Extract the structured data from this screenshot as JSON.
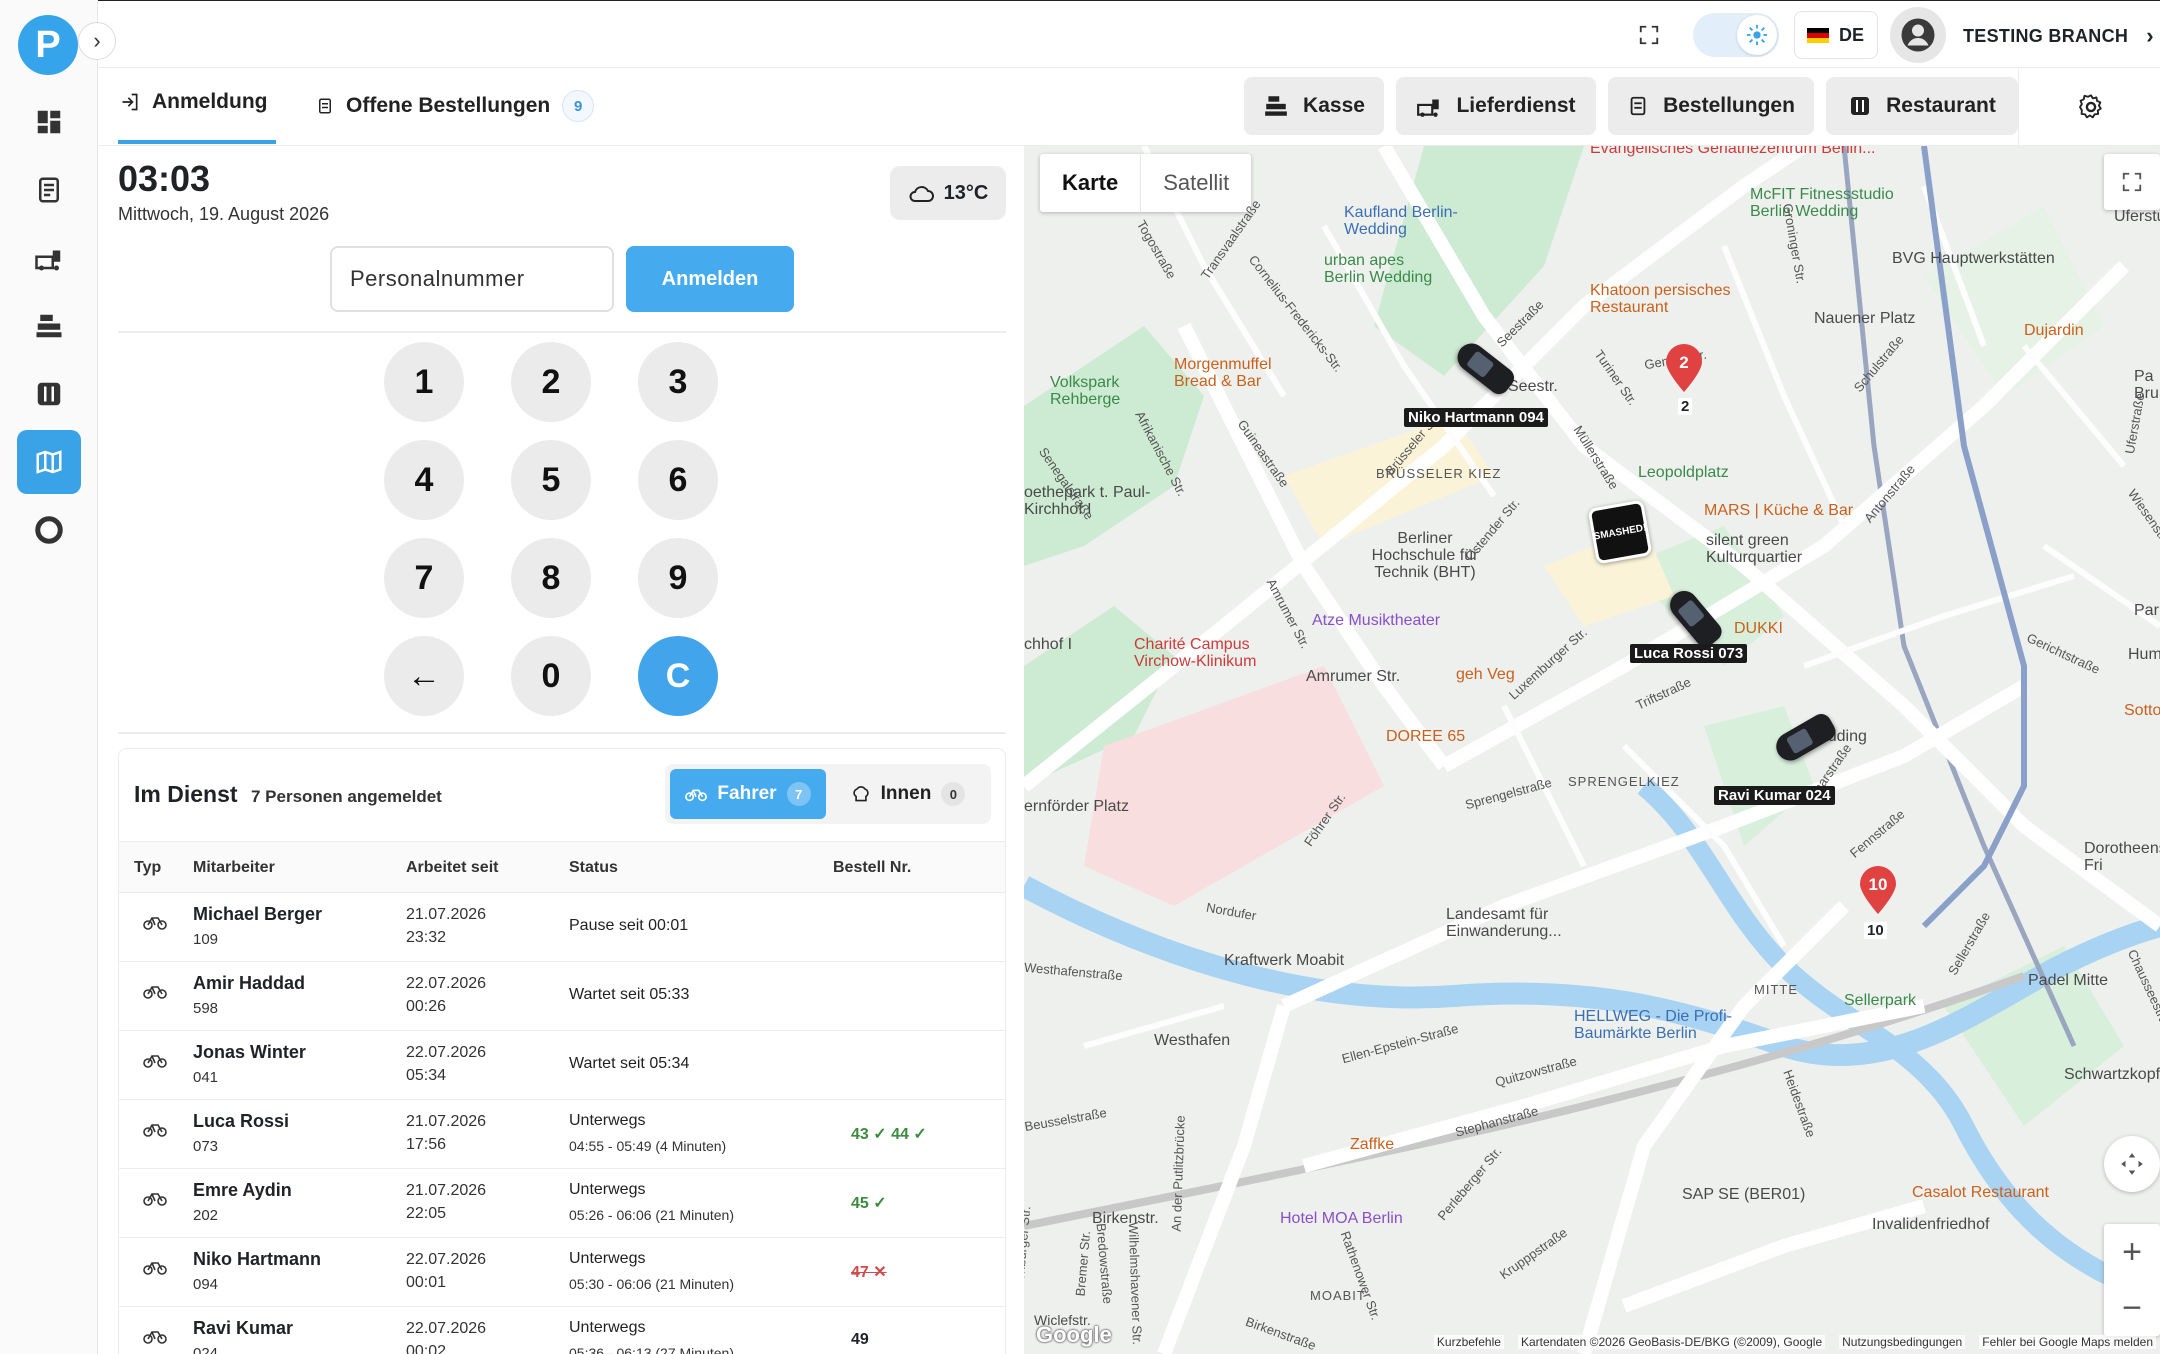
{
  "app": {
    "logo_letter": "P",
    "branch": "TESTING BRANCH",
    "language": "DE",
    "accent": "#45aaee"
  },
  "sidebar": {
    "items": [
      {
        "name": "dashboard-icon",
        "active": false
      },
      {
        "name": "receipt-icon",
        "active": false
      },
      {
        "name": "delivery-icon",
        "active": false
      },
      {
        "name": "cash-register-icon",
        "active": false
      },
      {
        "name": "restaurant-icon",
        "active": false
      },
      {
        "name": "map-icon",
        "active": true
      },
      {
        "name": "support-icon",
        "active": false
      }
    ]
  },
  "tabs": {
    "login": "Anmeldung",
    "open_orders": "Offene Bestellungen",
    "open_orders_count": "9"
  },
  "nav": {
    "kasse": "Kasse",
    "lieferdienst": "Lieferdienst",
    "bestellungen": "Bestellungen",
    "restaurant": "Restaurant"
  },
  "clock": {
    "time": "03:03",
    "date": "Mittwoch, 19. August 2026",
    "weather": "13°C"
  },
  "login": {
    "placeholder": "Personalnummer",
    "button": "Anmelden",
    "keys": [
      "1",
      "2",
      "3",
      "4",
      "5",
      "6",
      "7",
      "8",
      "9",
      "←",
      "0",
      "C"
    ]
  },
  "duty": {
    "title": "Im Dienst",
    "subtitle": "7 Personen angemeldet",
    "drivers_label": "Fahrer",
    "drivers_count": "7",
    "inside_label": "Innen",
    "inside_count": "0",
    "columns": [
      "Typ",
      "Mitarbeiter",
      "Arbeitet seit",
      "Status",
      "Bestell Nr."
    ],
    "rows": [
      {
        "name": "Michael Berger",
        "id": "109",
        "date": "21.07.2026",
        "time": "23:32",
        "status": "Pause seit 00:01",
        "detail": "",
        "orders": []
      },
      {
        "name": "Amir Haddad",
        "id": "598",
        "date": "22.07.2026",
        "time": "00:26",
        "status": "Wartet seit 05:33",
        "detail": "",
        "orders": []
      },
      {
        "name": "Jonas Winter",
        "id": "041",
        "date": "22.07.2026",
        "time": "05:34",
        "status": "Wartet seit 05:34",
        "detail": "",
        "orders": []
      },
      {
        "name": "Luca Rossi",
        "id": "073",
        "date": "21.07.2026",
        "time": "17:56",
        "status": "Unterwegs",
        "detail": "04:55 - 05:49 (4 Minuten)",
        "orders": [
          {
            "text": "43 ✓ 44 ✓",
            "state": "ok"
          }
        ]
      },
      {
        "name": "Emre Aydin",
        "id": "202",
        "date": "21.07.2026",
        "time": "22:05",
        "status": "Unterwegs",
        "detail": "05:26 - 06:06 (21 Minuten)",
        "orders": [
          {
            "text": "45 ✓",
            "state": "ok"
          }
        ]
      },
      {
        "name": "Niko Hartmann",
        "id": "094",
        "date": "22.07.2026",
        "time": "00:01",
        "status": "Unterwegs",
        "detail": "05:30 - 06:06 (21 Minuten)",
        "orders": [
          {
            "text": "47 ✕",
            "state": "bad"
          }
        ]
      },
      {
        "name": "Ravi Kumar",
        "id": "024",
        "date": "22.07.2026",
        "time": "00:02",
        "status": "Unterwegs",
        "detail": "05:36 - 06:13 (27 Minuten)",
        "orders": [
          {
            "text": "49",
            "state": "plain"
          }
        ]
      }
    ]
  },
  "map": {
    "type_map": "Karte",
    "type_satellite": "Satellit",
    "drivers": [
      "Niko Hartmann 094",
      "Luca Rossi 073",
      "Ravi Kumar 024"
    ],
    "pins": [
      "2",
      "10"
    ],
    "pin_labels": [
      "2",
      "10"
    ],
    "store_logo": "SMASHED!",
    "labels": {
      "l1": "Evangelisches Geriatriezentrum Berlin...",
      "l2": "McFIT Fitnessstudio Berlin Wedding",
      "l3": "Uferstudio",
      "l4": "Kaufland Berlin-Wedding",
      "l5": "urban apes Berlin Wedding",
      "l6": "BVG Hauptwerkstätten",
      "l7": "Khatoon persisches Restaurant",
      "l8": "Nauener Platz",
      "l9": "Dujardin",
      "l10": "Morgenmuffel Bread & Bar",
      "l11": "Volkspark Rehberge",
      "l12": "Seestr.",
      "l13": "Leopoldplatz",
      "l14": "BRÜSSELER KIEZ",
      "l15": "oethepark t. Paul-Kirchhof I",
      "l16": "MARS | Küche & Bar",
      "l17": "silent green Kulturquartier",
      "l18": "Berliner Hochschule für Technik (BHT)",
      "l19": "DUKKI",
      "l20": "Atze Musiktheater",
      "l21": "Charité Campus Virchow-Klinikum",
      "l22": "Amrumer Str.",
      "l23": "geh Veg",
      "l24": "SPRENGELKIEZ",
      "l25": "Wedding",
      "l26": "DOREE 65",
      "l27": "Dorotheenst Fri",
      "l28": "Landesamt für Einwanderung...",
      "l29": "Kraftwerk Moabit",
      "l30": "MITTE",
      "l31": "Padel Mitte",
      "l32": "Sellerpark",
      "l33": "HELLWEG - Die Profi-Baumärkte Berlin",
      "l34": "Westhafen",
      "l35": "Schwartzkopf",
      "l36": "Zaffke",
      "l37": "SAP SE (BER01)",
      "l38": "Casalot Restaurant",
      "l39": "Invalidenfriedhof",
      "l40": "Birkenstr.",
      "l41": "Hotel MOA Berlin",
      "l42": "MOABIT",
      "l43": "ernförder Platz",
      "l44": "chhof I",
      "l45": "Wiclefstr.",
      "l46": "Pa Brun",
      "l47": "Par",
      "l48": "Hum",
      "l49": "Sotto"
    },
    "streets": {
      "s1": "Transvaalstraße",
      "s2": "Seestraße",
      "s3": "Müllerstraße",
      "s4": "Afrikanische Str.",
      "s5": "Amrumer Str.",
      "s6": "Luxemburger Str.",
      "s7": "Föhrer Str.",
      "s8": "Triftstraße",
      "s9": "Fennstraße",
      "s10": "Sellerstraße",
      "s11": "Ellen-Epstein-Straße",
      "s12": "Heidestraße",
      "s13": "Perleberger Str.",
      "s14": "Rathenower Str.",
      "s15": "Stephanstraße",
      "s16": "Quitzowstraße",
      "s17": "Schulstraße",
      "s18": "Antonstraße",
      "s19": "Sprengelstraße",
      "s20": "Nordufer",
      "s21": "Guineastraße",
      "s22": "Togostraße",
      "s23": "Cornelius-Fredericks-Str.",
      "s24": "Ostender Str.",
      "s25": "Brüsseler Str.",
      "s26": "Turiner Str.",
      "s27": "Genter Str.",
      "s28": "Groninger Str.",
      "s29": "Senegalstraße",
      "s30": "An der Putlitzbrücke",
      "s31": "Birkenstraße",
      "s32": "Bremer Str.",
      "s33": "Krupppstraße",
      "s34": "Lynarstraße",
      "s35": "Gerichtstraße",
      "s36": "Uferstraße",
      "s37": "Wiesenstraße",
      "s38": "Chausseestraße",
      "s39": "Wilhelmshavener Str.",
      "s40": "Bredowstraße",
      "s41": "Oldenburger Str.",
      "s42": "Beusselstraße",
      "s43": "Kurzbefehle",
      "s44": "Westhafenstraße"
    },
    "attribution": {
      "logo": "Google",
      "shortcuts": "Kurzbefehle",
      "data": "Kartendaten ©2026 GeoBasis-DE/BKG (©2009), Google",
      "terms": "Nutzungsbedingungen",
      "report": "Fehler bei Google Maps melden"
    },
    "zoom_in": "+",
    "zoom_out": "−"
  }
}
